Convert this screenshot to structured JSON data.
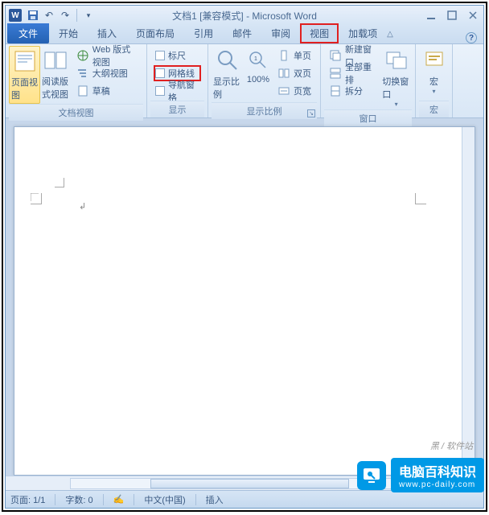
{
  "title": "文档1 [兼容模式] - Microsoft Word",
  "app_icon_letter": "W",
  "tabs": {
    "file": "文件",
    "home": "开始",
    "insert": "插入",
    "layout": "页面布局",
    "refs": "引用",
    "mail": "邮件",
    "review": "审阅",
    "view": "视图",
    "addin": "加载项"
  },
  "ribbon": {
    "views": {
      "page": "页面视图",
      "read": "阅读版式视图",
      "web": "Web 版式视图",
      "outline": "大纲视图",
      "draft": "草稿",
      "group": "文档视图"
    },
    "show": {
      "ruler": "标尺",
      "gridlines": "网格线",
      "navpane": "导航窗格",
      "group": "显示"
    },
    "zoom": {
      "zoom": "显示比例",
      "hundred": "100%",
      "onepage": "单页",
      "twopage": "双页",
      "pagewidth": "页宽",
      "group": "显示比例"
    },
    "window": {
      "newwin": "新建窗口",
      "arrange": "全部重排",
      "split": "拆分",
      "switch": "切换窗口",
      "group": "窗口"
    },
    "macros": {
      "macro": "宏",
      "group": "宏"
    }
  },
  "status": {
    "page": "页面: 1/1",
    "words": "字数: 0",
    "lang": "中文(中国)",
    "mode": "插入"
  },
  "watermark": {
    "brand_cn": "电脑百科知识",
    "brand_url": "www.pc-daily.com",
    "small": "黑 / 软件站"
  }
}
